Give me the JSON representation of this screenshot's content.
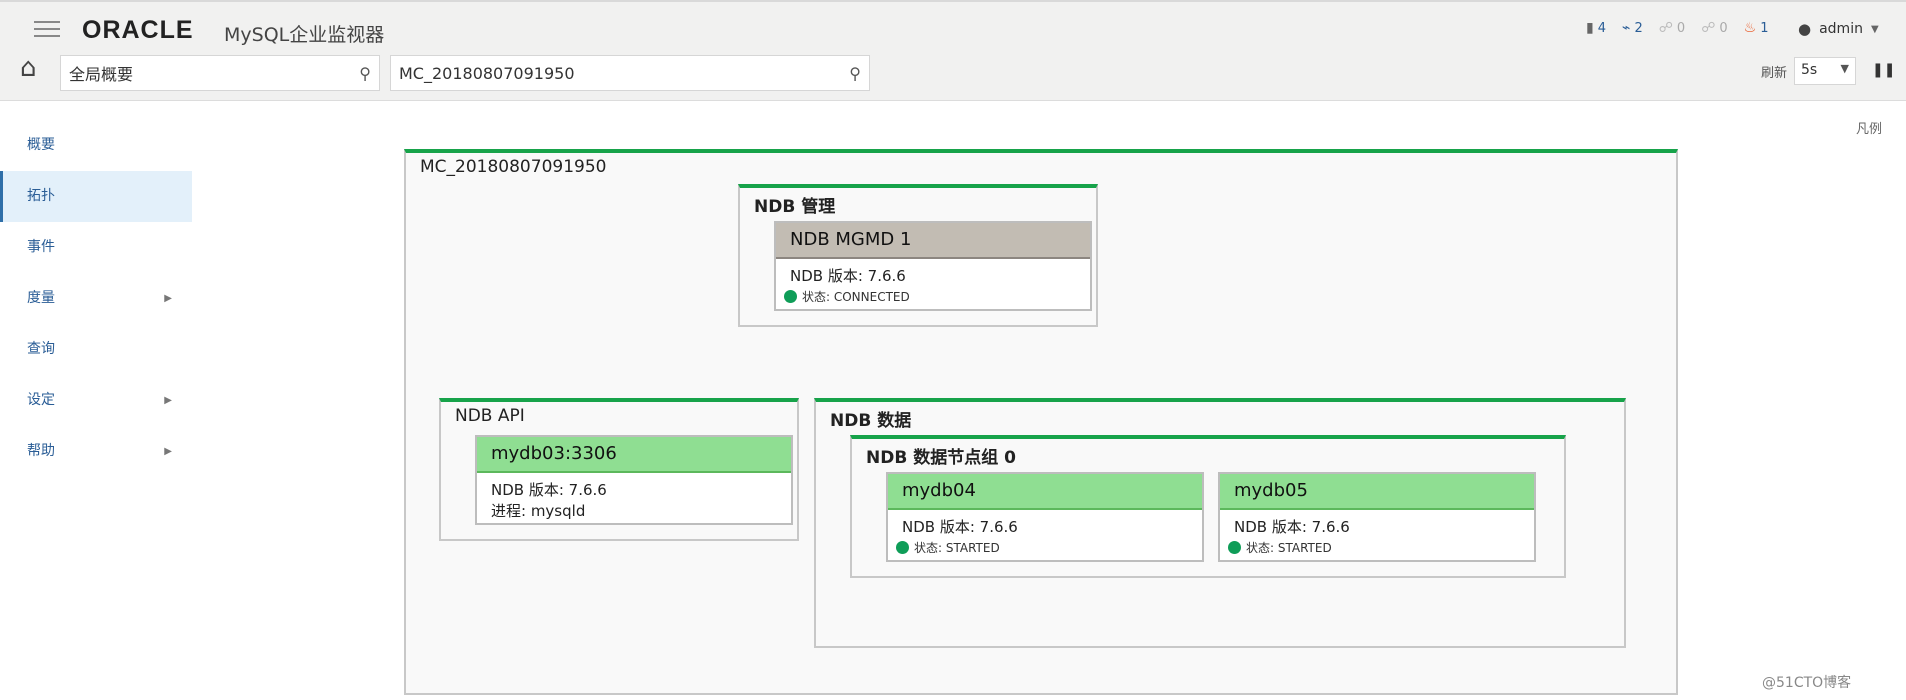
{
  "header": {
    "logo": "ORACLE",
    "product": "MySQL企业监视器",
    "status": [
      {
        "icon": "server-icon",
        "count": "4"
      },
      {
        "icon": "agent-icon",
        "count": "2"
      },
      {
        "icon": "info-event-icon",
        "count": "0"
      },
      {
        "icon": "warning-event-icon",
        "count": "0"
      },
      {
        "icon": "critical-event-icon",
        "count": "1"
      }
    ],
    "user": "admin",
    "search1": "全局概要",
    "search2": "MC_20180807091950",
    "refresh_label": "刷新",
    "refresh_value": "5s"
  },
  "sidebar": {
    "items": [
      {
        "label": "概要"
      },
      {
        "label": "拓扑"
      },
      {
        "label": "事件"
      },
      {
        "label": "度量"
      },
      {
        "label": "查询"
      },
      {
        "label": "设定"
      },
      {
        "label": "帮助"
      }
    ]
  },
  "legend": "凡例",
  "topology": {
    "cluster_name": "MC_20180807091950",
    "mgmt": {
      "title": "NDB 管理",
      "node": {
        "name": "NDB MGMD 1",
        "version": "NDB 版本: 7.6.6",
        "status": "状态: CONNECTED"
      }
    },
    "api": {
      "title": "NDB API",
      "node": {
        "name": "mydb03:3306",
        "version": "NDB 版本: 7.6.6",
        "process": "进程: mysqld"
      }
    },
    "data": {
      "title": "NDB 数据",
      "group_title": "NDB 数据节点组 0",
      "nodes": [
        {
          "name": "mydb04",
          "version": "NDB 版本: 7.6.6",
          "status": "状态: STARTED"
        },
        {
          "name": "mydb05",
          "version": "NDB 版本: 7.6.6",
          "status": "状态: STARTED"
        }
      ]
    }
  },
  "watermark": "@51CTO博客"
}
